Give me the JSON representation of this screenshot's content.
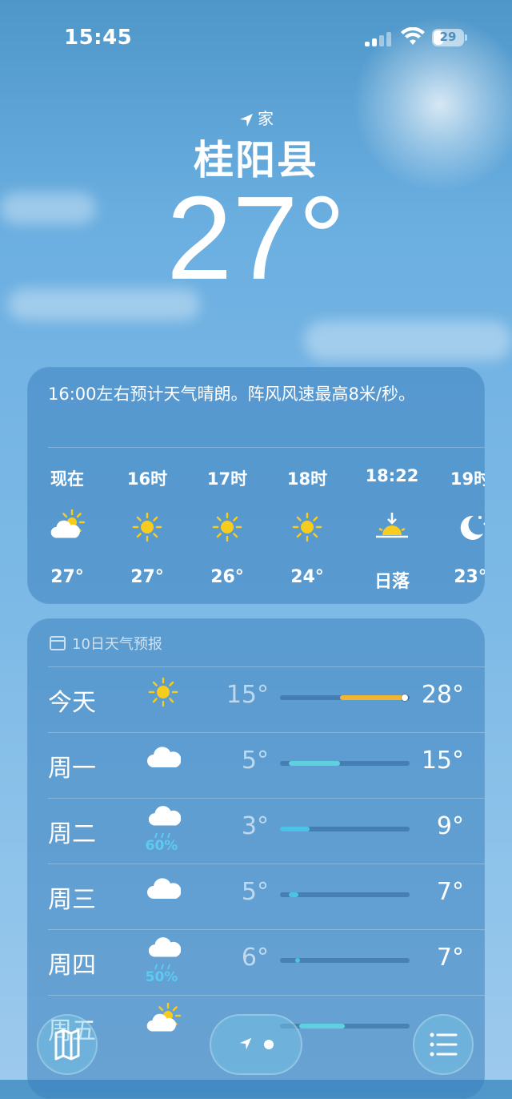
{
  "status_bar": {
    "time": "15:45",
    "battery": "29"
  },
  "location": {
    "tag": "家",
    "city": "桂阳县",
    "temperature": "27°"
  },
  "hourly": {
    "summary": "16:00左右预计天气晴朗。阵风风速最高8米/秒。",
    "items": [
      {
        "label": "现在",
        "icon": "partly-cloudy-sun-icon",
        "value": "27°"
      },
      {
        "label": "16时",
        "icon": "sun-icon",
        "value": "27°"
      },
      {
        "label": "17时",
        "icon": "sun-icon",
        "value": "26°"
      },
      {
        "label": "18时",
        "icon": "sun-icon",
        "value": "24°"
      },
      {
        "label": "18:22",
        "icon": "sunset-icon",
        "value": "日落"
      },
      {
        "label": "19时",
        "icon": "moon-stars-icon",
        "value": "23°"
      }
    ]
  },
  "daily": {
    "title": "10日天气预报",
    "days": [
      {
        "name": "今天",
        "icon": "sun-icon",
        "precip": "",
        "low": "15°",
        "high": "28°",
        "range_start": 0.46,
        "range_end": 0.96,
        "now": 0.96,
        "color": "#f2b632"
      },
      {
        "name": "周一",
        "icon": "cloud-icon",
        "precip": "",
        "low": "5°",
        "high": "15°",
        "range_start": 0.07,
        "range_end": 0.46,
        "color": "#5fd0e0"
      },
      {
        "name": "周二",
        "icon": "rain-cloud-icon",
        "precip": "60%",
        "low": "3°",
        "high": "9°",
        "range_start": 0.0,
        "range_end": 0.23,
        "color": "#4cc3e6"
      },
      {
        "name": "周三",
        "icon": "cloud-icon",
        "precip": "",
        "low": "5°",
        "high": "7°",
        "range_start": 0.07,
        "range_end": 0.14,
        "color": "#4cc3e6"
      },
      {
        "name": "周四",
        "icon": "rain-cloud-icon",
        "precip": "50%",
        "low": "6°",
        "high": "7°",
        "range_start": 0.12,
        "range_end": 0.15,
        "color": "#4cc3e6"
      },
      {
        "name": "周五",
        "icon": "partly-cloudy-sun-icon",
        "precip": "",
        "low": "",
        "high": "",
        "range_start": 0.15,
        "range_end": 0.5,
        "color": "#5fd0e0"
      }
    ]
  },
  "tab_bar": {
    "map": "map-icon",
    "location": "location-dots",
    "list": "list-icon"
  }
}
